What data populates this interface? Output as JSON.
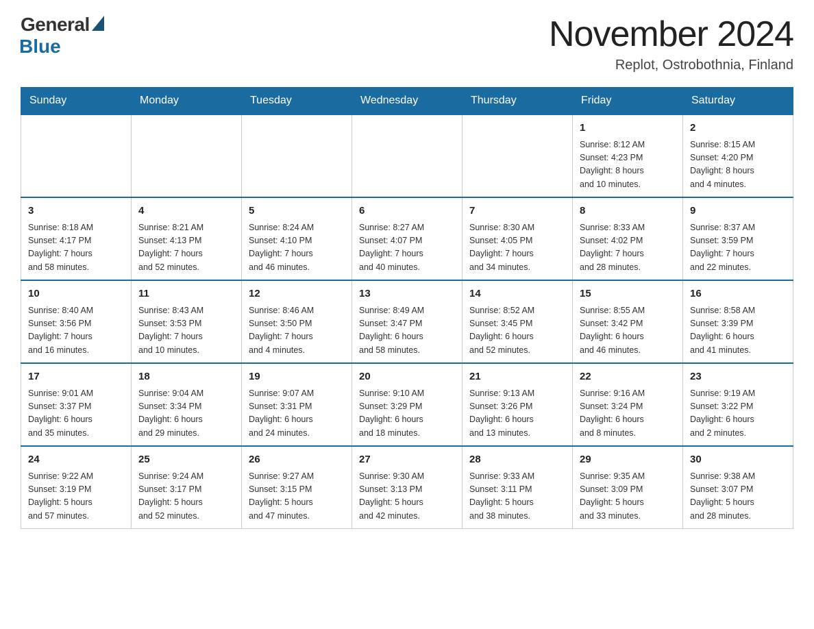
{
  "header": {
    "logo_general": "General",
    "logo_blue": "Blue",
    "month_title": "November 2024",
    "location": "Replot, Ostrobothnia, Finland"
  },
  "days_of_week": [
    "Sunday",
    "Monday",
    "Tuesday",
    "Wednesday",
    "Thursday",
    "Friday",
    "Saturday"
  ],
  "weeks": [
    [
      {
        "day": "",
        "info": ""
      },
      {
        "day": "",
        "info": ""
      },
      {
        "day": "",
        "info": ""
      },
      {
        "day": "",
        "info": ""
      },
      {
        "day": "",
        "info": ""
      },
      {
        "day": "1",
        "info": "Sunrise: 8:12 AM\nSunset: 4:23 PM\nDaylight: 8 hours\nand 10 minutes."
      },
      {
        "day": "2",
        "info": "Sunrise: 8:15 AM\nSunset: 4:20 PM\nDaylight: 8 hours\nand 4 minutes."
      }
    ],
    [
      {
        "day": "3",
        "info": "Sunrise: 8:18 AM\nSunset: 4:17 PM\nDaylight: 7 hours\nand 58 minutes."
      },
      {
        "day": "4",
        "info": "Sunrise: 8:21 AM\nSunset: 4:13 PM\nDaylight: 7 hours\nand 52 minutes."
      },
      {
        "day": "5",
        "info": "Sunrise: 8:24 AM\nSunset: 4:10 PM\nDaylight: 7 hours\nand 46 minutes."
      },
      {
        "day": "6",
        "info": "Sunrise: 8:27 AM\nSunset: 4:07 PM\nDaylight: 7 hours\nand 40 minutes."
      },
      {
        "day": "7",
        "info": "Sunrise: 8:30 AM\nSunset: 4:05 PM\nDaylight: 7 hours\nand 34 minutes."
      },
      {
        "day": "8",
        "info": "Sunrise: 8:33 AM\nSunset: 4:02 PM\nDaylight: 7 hours\nand 28 minutes."
      },
      {
        "day": "9",
        "info": "Sunrise: 8:37 AM\nSunset: 3:59 PM\nDaylight: 7 hours\nand 22 minutes."
      }
    ],
    [
      {
        "day": "10",
        "info": "Sunrise: 8:40 AM\nSunset: 3:56 PM\nDaylight: 7 hours\nand 16 minutes."
      },
      {
        "day": "11",
        "info": "Sunrise: 8:43 AM\nSunset: 3:53 PM\nDaylight: 7 hours\nand 10 minutes."
      },
      {
        "day": "12",
        "info": "Sunrise: 8:46 AM\nSunset: 3:50 PM\nDaylight: 7 hours\nand 4 minutes."
      },
      {
        "day": "13",
        "info": "Sunrise: 8:49 AM\nSunset: 3:47 PM\nDaylight: 6 hours\nand 58 minutes."
      },
      {
        "day": "14",
        "info": "Sunrise: 8:52 AM\nSunset: 3:45 PM\nDaylight: 6 hours\nand 52 minutes."
      },
      {
        "day": "15",
        "info": "Sunrise: 8:55 AM\nSunset: 3:42 PM\nDaylight: 6 hours\nand 46 minutes."
      },
      {
        "day": "16",
        "info": "Sunrise: 8:58 AM\nSunset: 3:39 PM\nDaylight: 6 hours\nand 41 minutes."
      }
    ],
    [
      {
        "day": "17",
        "info": "Sunrise: 9:01 AM\nSunset: 3:37 PM\nDaylight: 6 hours\nand 35 minutes."
      },
      {
        "day": "18",
        "info": "Sunrise: 9:04 AM\nSunset: 3:34 PM\nDaylight: 6 hours\nand 29 minutes."
      },
      {
        "day": "19",
        "info": "Sunrise: 9:07 AM\nSunset: 3:31 PM\nDaylight: 6 hours\nand 24 minutes."
      },
      {
        "day": "20",
        "info": "Sunrise: 9:10 AM\nSunset: 3:29 PM\nDaylight: 6 hours\nand 18 minutes."
      },
      {
        "day": "21",
        "info": "Sunrise: 9:13 AM\nSunset: 3:26 PM\nDaylight: 6 hours\nand 13 minutes."
      },
      {
        "day": "22",
        "info": "Sunrise: 9:16 AM\nSunset: 3:24 PM\nDaylight: 6 hours\nand 8 minutes."
      },
      {
        "day": "23",
        "info": "Sunrise: 9:19 AM\nSunset: 3:22 PM\nDaylight: 6 hours\nand 2 minutes."
      }
    ],
    [
      {
        "day": "24",
        "info": "Sunrise: 9:22 AM\nSunset: 3:19 PM\nDaylight: 5 hours\nand 57 minutes."
      },
      {
        "day": "25",
        "info": "Sunrise: 9:24 AM\nSunset: 3:17 PM\nDaylight: 5 hours\nand 52 minutes."
      },
      {
        "day": "26",
        "info": "Sunrise: 9:27 AM\nSunset: 3:15 PM\nDaylight: 5 hours\nand 47 minutes."
      },
      {
        "day": "27",
        "info": "Sunrise: 9:30 AM\nSunset: 3:13 PM\nDaylight: 5 hours\nand 42 minutes."
      },
      {
        "day": "28",
        "info": "Sunrise: 9:33 AM\nSunset: 3:11 PM\nDaylight: 5 hours\nand 38 minutes."
      },
      {
        "day": "29",
        "info": "Sunrise: 9:35 AM\nSunset: 3:09 PM\nDaylight: 5 hours\nand 33 minutes."
      },
      {
        "day": "30",
        "info": "Sunrise: 9:38 AM\nSunset: 3:07 PM\nDaylight: 5 hours\nand 28 minutes."
      }
    ]
  ]
}
